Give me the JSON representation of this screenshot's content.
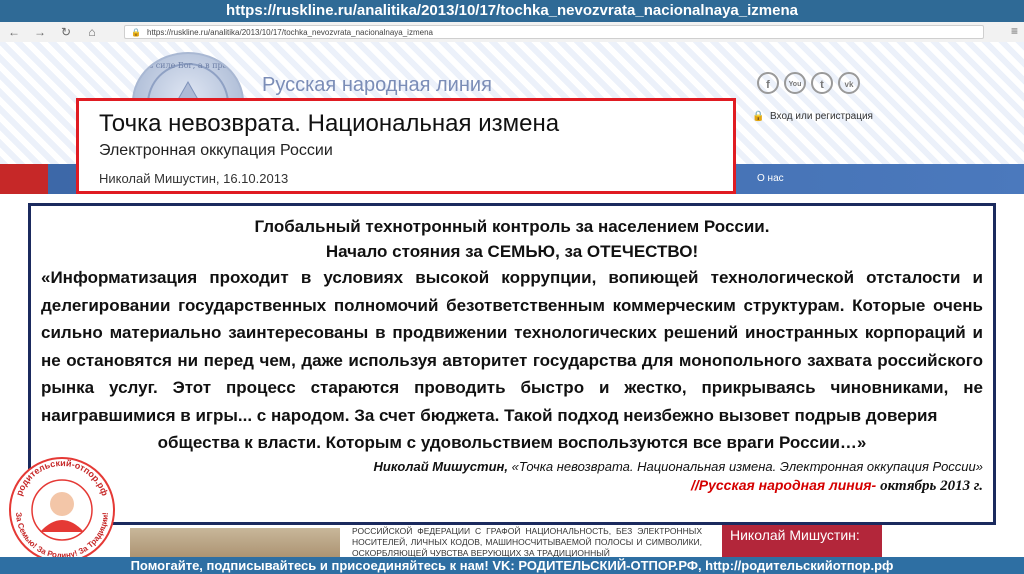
{
  "top_banner": {
    "url": "https://ruskline.ru/analitika/2013/10/17/tochka_nevozvrata_nacionalnaya_izmena"
  },
  "browser": {
    "address": "https://ruskline.ru/analitika/2013/10/17/tochka_nevozvrata_nacionalnaya_izmena",
    "back_icon": "arrow-left-icon",
    "forward_icon": "arrow-right-icon",
    "reload_icon": "reload-icon",
    "home_icon": "home-icon",
    "menu_icon": "menu-icon"
  },
  "site": {
    "seal_text": "Не в силе Бог, а в правде",
    "title": "Русская народная линия",
    "login": "Вход или регистрация",
    "login_icon": "lock-icon",
    "social": [
      "f",
      "You",
      "t",
      "vk"
    ],
    "nav_item": "О нас"
  },
  "headline": {
    "title": "Точка невозврата. Национальная измена",
    "subtitle": "Электронная оккупация России",
    "byline": "Николай Мишустин, 16.10.2013"
  },
  "quote": {
    "heading1": "Глобальный технотронный контроль за населением России.",
    "heading2": "Начало стояния  за СЕМЬЮ,  за ОТЕЧЕСТВО!",
    "body": " «Информатизация проходит в условиях высокой коррупции, вопиющей технологической отсталости и делегировании государственных полномочий безответственным коммерческим структурам. Которые очень сильно материально заинтересованы в продвижении технологических  решений иностранных корпораций и не остановятся ни перед чем, даже используя  авторитет  государства для монопольного захвата российского рынка услуг. Этот процесс стараются проводить быстро и жестко, прикрываясь чиновниками, не наигравшимися в игры... с народом. За счет бюджета. Такой подход неизбежно вызовет подрыв доверия",
    "tail": "общества к власти. Которым   с удовольствием воспользуются все враги  России…»",
    "cite_author": "Николай Мишустин,",
    "cite_work": " «Точка невозврата. Национальная измена. Электронная оккупация России»",
    "source": "//Русская народная линия- ",
    "source_date": "октябрь 2013 г."
  },
  "page_below": {
    "text": "РОССИЙСКОЙ ФЕДЕРАЦИИ С ГРАФОЙ НАЦИОНАЛЬНОСТЬ, БЕЗ ЭЛЕКТРОННЫХ НОСИТЕЛЕЙ, ЛИЧНЫХ КОДОВ, МАШИНОСЧИТЫВАЕМОЙ ПОЛОСЫ И СИМВОЛИКИ, ОСКОРБЛЯЮЩЕЙ ЧУВСТВА ВЕРУЮЩИХ ЗА ТРАДИЦИОННЫЙ",
    "author_card": "Николай Мишустин:"
  },
  "stamp": {
    "top_text": "родительский-отпор.рф",
    "bottom_text": "За Семью! За Родину! За Традиции!"
  },
  "bottom_banner": "Помогайте, подписывайтесь и присоединяйтесь к нам! VK: РОДИТЕЛЬСКИЙ-ОТПОР.РФ, http://родительскийотпор.рф"
}
